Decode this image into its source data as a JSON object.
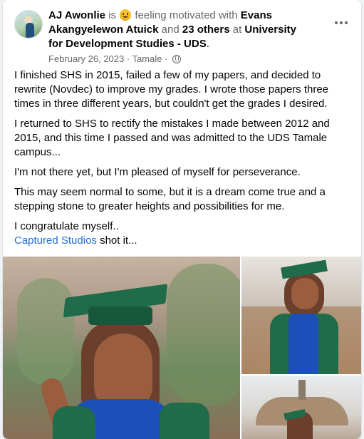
{
  "post": {
    "author": "AJ Awonlie",
    "is_text": " is ",
    "feeling_text": " feeling motivated with ",
    "tagged": "Evans Akangyelewon Atuick",
    "and_text": " and ",
    "others": "23 others",
    "at_text": " at ",
    "location": "University for Development Studies - UDS",
    "period": ".",
    "date": "February 26, 2023",
    "sep": " · ",
    "place": "Tamale",
    "sep2": " · ",
    "privacy_icon": "globe-icon",
    "more_icon": "more-options-icon",
    "emoji_icon": "smiling-face-icon"
  },
  "body": {
    "p1": "I finished SHS in 2015, failed a few of my papers, and decided to rewrite (Novdec) to improve my grades. I wrote those papers three times in three different years, but couldn't get the grades I desired.",
    "p2": "I returned to SHS to rectify the mistakes I made between 2012 and 2015, and this time I passed and was admitted to the UDS Tamale campus...",
    "p3": "I'm not there yet, but I'm pleased of myself for perseverance.",
    "p4": "This may seem normal to some, but it is a dream come true and a stepping stone to greater heights and possibilities for me.",
    "p5": "I congratulate myself..",
    "credit_link": "Captured Studios",
    "credit_rest": " shot it..."
  },
  "colors": {
    "link": "#216fdb",
    "secondary_text": "#65676b",
    "gown_green": "#1f6b4a",
    "dress_blue": "#1d4fb8"
  }
}
